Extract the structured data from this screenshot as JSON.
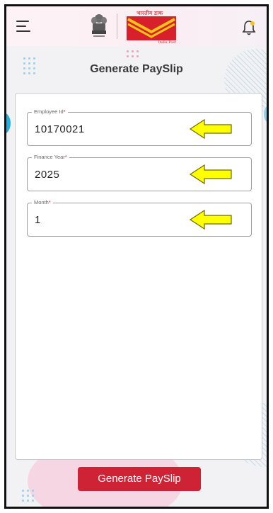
{
  "header": {
    "menu_icon": "hamburger-menu-icon",
    "emblem_icon": "national-emblem-icon",
    "logo_hindi": "भारतीय डाक",
    "logo_english": "India Post",
    "notification_icon": "bell-icon"
  },
  "page": {
    "title": "Generate PaySlip"
  },
  "form": {
    "fields": [
      {
        "label": "Employee Id",
        "required_mark": "*",
        "value": "10170021"
      },
      {
        "label": "Finance Year",
        "required_mark": "*",
        "value": "2025"
      },
      {
        "label": "Month",
        "required_mark": "*",
        "value": "1"
      }
    ],
    "pointer_icon": "yellow-arrow-icon"
  },
  "actions": {
    "submit_label": "Generate PaySlip"
  },
  "colors": {
    "brand_red": "#cd2334",
    "arrow_yellow": "#ffff00",
    "header_bg": "#fbeef3"
  }
}
